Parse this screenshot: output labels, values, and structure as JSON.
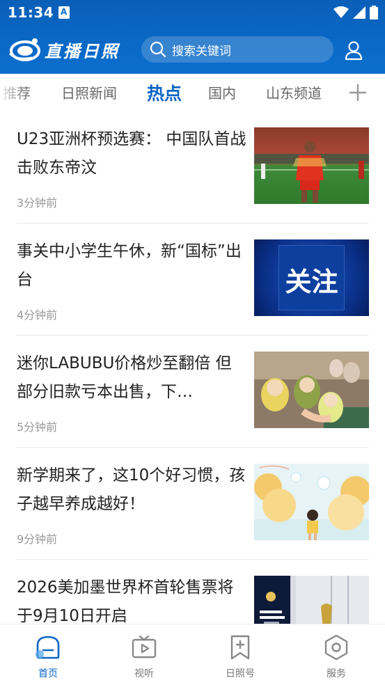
{
  "status_bar": {
    "time": "11:34"
  },
  "header": {
    "logo_text": "直播日照",
    "search_placeholder": "搜索关键词"
  },
  "tabs": [
    {
      "label": "推荐"
    },
    {
      "label": "日照新闻"
    },
    {
      "label": "热点",
      "active": true
    },
    {
      "label": "国内"
    },
    {
      "label": "山东频道"
    }
  ],
  "news": [
    {
      "title": "U23亚洲杯预选赛： 中国队首战击败东帝汶",
      "time": "3分钟前",
      "thumb": "soccer-player-photo"
    },
    {
      "title": "事关中小学生午休，新“国标”出台",
      "time": "4分钟前",
      "thumb": "关注"
    },
    {
      "title": "迷你LABUBU价格炒至翻倍 但部分旧款亏本出售，下…",
      "time": "5分钟前",
      "thumb": "labubu-toys-photo"
    },
    {
      "title": "新学期来了，这10个好习惯，孩子越早养成越好！",
      "time": "9分钟前",
      "thumb": "child-illustration"
    },
    {
      "title": "2026美加墨世界杯首轮售票将于9月10日开启",
      "time": "",
      "thumb": "fifa-world-cup-photo"
    }
  ],
  "bottom_nav": [
    {
      "label": "首页",
      "icon": "home-icon",
      "active": true
    },
    {
      "label": "视听",
      "icon": "tv-icon"
    },
    {
      "label": "日照号",
      "icon": "add-bookmark-icon"
    },
    {
      "label": "服务",
      "icon": "hexagon-service-icon"
    }
  ],
  "colors": {
    "brand_blue": "#0b6fcf",
    "active_tab": "#0b64c4"
  }
}
